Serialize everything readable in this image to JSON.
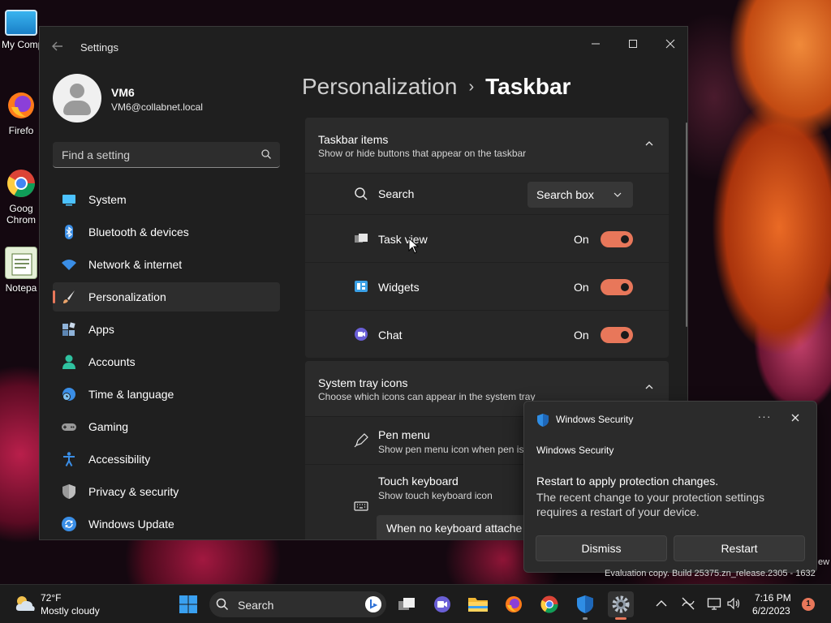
{
  "desktop": {
    "icons": [
      {
        "label": "My Comp",
        "icon": "computer-icon"
      },
      {
        "label": "Firefo",
        "icon": "firefox-icon"
      },
      {
        "label": "Goog",
        "label2": "Chrom",
        "icon": "chrome-icon"
      },
      {
        "label": "Notepa",
        "icon": "notepad-icon"
      }
    ]
  },
  "window": {
    "title": "Settings",
    "controls": {
      "minimize": "minimize-icon",
      "maximize": "maximize-icon",
      "close": "close-icon"
    }
  },
  "profile": {
    "name": "VM6",
    "email": "VM6@collabnet.local"
  },
  "search": {
    "placeholder": "Find a setting"
  },
  "nav": {
    "items": [
      {
        "label": "System",
        "icon": "system-icon",
        "color": "#4cc2ff"
      },
      {
        "label": "Bluetooth & devices",
        "icon": "bluetooth-icon",
        "color": "#3a8ee6"
      },
      {
        "label": "Network & internet",
        "icon": "wifi-icon",
        "color": "#3a8ee6"
      },
      {
        "label": "Personalization",
        "icon": "brush-icon",
        "color": "#e8a26a",
        "selected": true
      },
      {
        "label": "Apps",
        "icon": "apps-icon",
        "color": "#8fb3d9"
      },
      {
        "label": "Accounts",
        "icon": "accounts-icon",
        "color": "#2fc2a0"
      },
      {
        "label": "Time & language",
        "icon": "time-language-icon",
        "color": "#3a8ee6"
      },
      {
        "label": "Gaming",
        "icon": "gaming-icon",
        "color": "#9a9a9a"
      },
      {
        "label": "Accessibility",
        "icon": "accessibility-icon",
        "color": "#3a8ee6"
      },
      {
        "label": "Privacy & security",
        "icon": "shield-icon",
        "color": "#9a9a9a"
      },
      {
        "label": "Windows Update",
        "icon": "windows-update-icon",
        "color": "#3a8ee6"
      }
    ]
  },
  "breadcrumb": {
    "parent": "Personalization",
    "separator": "›",
    "current": "Taskbar"
  },
  "taskbar_items": {
    "title": "Taskbar items",
    "subtitle": "Show or hide buttons that appear on the taskbar",
    "rows": [
      {
        "label": "Search",
        "icon": "search-icon",
        "control": "dropdown",
        "value": "Search box"
      },
      {
        "label": "Task view",
        "icon": "task-view-icon",
        "control": "toggle",
        "state": "On"
      },
      {
        "label": "Widgets",
        "icon": "widgets-icon",
        "control": "toggle",
        "state": "On"
      },
      {
        "label": "Chat",
        "icon": "chat-icon",
        "control": "toggle",
        "state": "On"
      }
    ]
  },
  "tray_icons": {
    "title": "System tray icons",
    "subtitle": "Choose which icons can appear in the system tray",
    "rows": [
      {
        "label": "Pen menu",
        "sub": "Show pen menu icon when pen is",
        "icon": "pen-icon"
      },
      {
        "label": "Touch keyboard",
        "sub": "Show touch keyboard icon",
        "icon": "keyboard-icon",
        "dropdown_value": "When no keyboard attache"
      }
    ]
  },
  "toast": {
    "app": "Windows Security",
    "more": "···",
    "source": "Windows Security",
    "headline": "Restart to apply protection changes.",
    "body": "The recent change to your protection settings requires a restart of your device.",
    "dismiss": "Dismiss",
    "restart": "Restart"
  },
  "watermark": {
    "line": "Evaluation copy. Build 25375.zn_release.2305 - 1632",
    "edge": "ew"
  },
  "taskbar": {
    "weather": {
      "temp": "72°F",
      "desc": "Mostly cloudy"
    },
    "search_label": "Search",
    "apps": [
      "start-icon",
      "search",
      "task-view-icon",
      "teams-chat-icon",
      "file-explorer-icon",
      "firefox-icon",
      "chrome-icon",
      "windows-security-icon",
      "settings-icon"
    ],
    "clock": {
      "time": "7:16 PM",
      "date": "6/2/2023"
    },
    "notifications": "1"
  },
  "colors": {
    "accent": "#e8775a",
    "window_bg": "#1f1f1f",
    "card_bg": "#2b2b2b"
  }
}
